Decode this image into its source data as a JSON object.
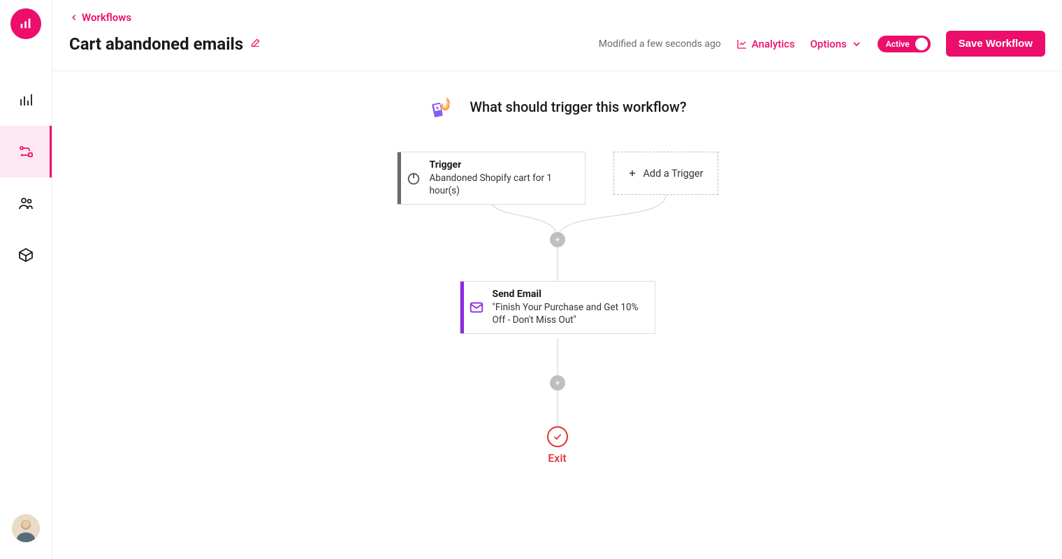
{
  "breadcrumb": {
    "label": "Workflows"
  },
  "page": {
    "title": "Cart abandoned emails"
  },
  "header": {
    "modified": "Modified a few seconds ago",
    "analytics": "Analytics",
    "options": "Options",
    "toggle_label": "Active",
    "save": "Save Workflow"
  },
  "canvas": {
    "hero": "What should trigger this workflow?",
    "trigger": {
      "title": "Trigger",
      "desc": "Abandoned Shopify cart for 1 hour(s)"
    },
    "add_trigger": "Add a Trigger",
    "email": {
      "title": "Send Email",
      "desc": "\"Finish Your Purchase and Get 10% Off - Don't Miss Out\""
    },
    "exit": "Exit"
  }
}
